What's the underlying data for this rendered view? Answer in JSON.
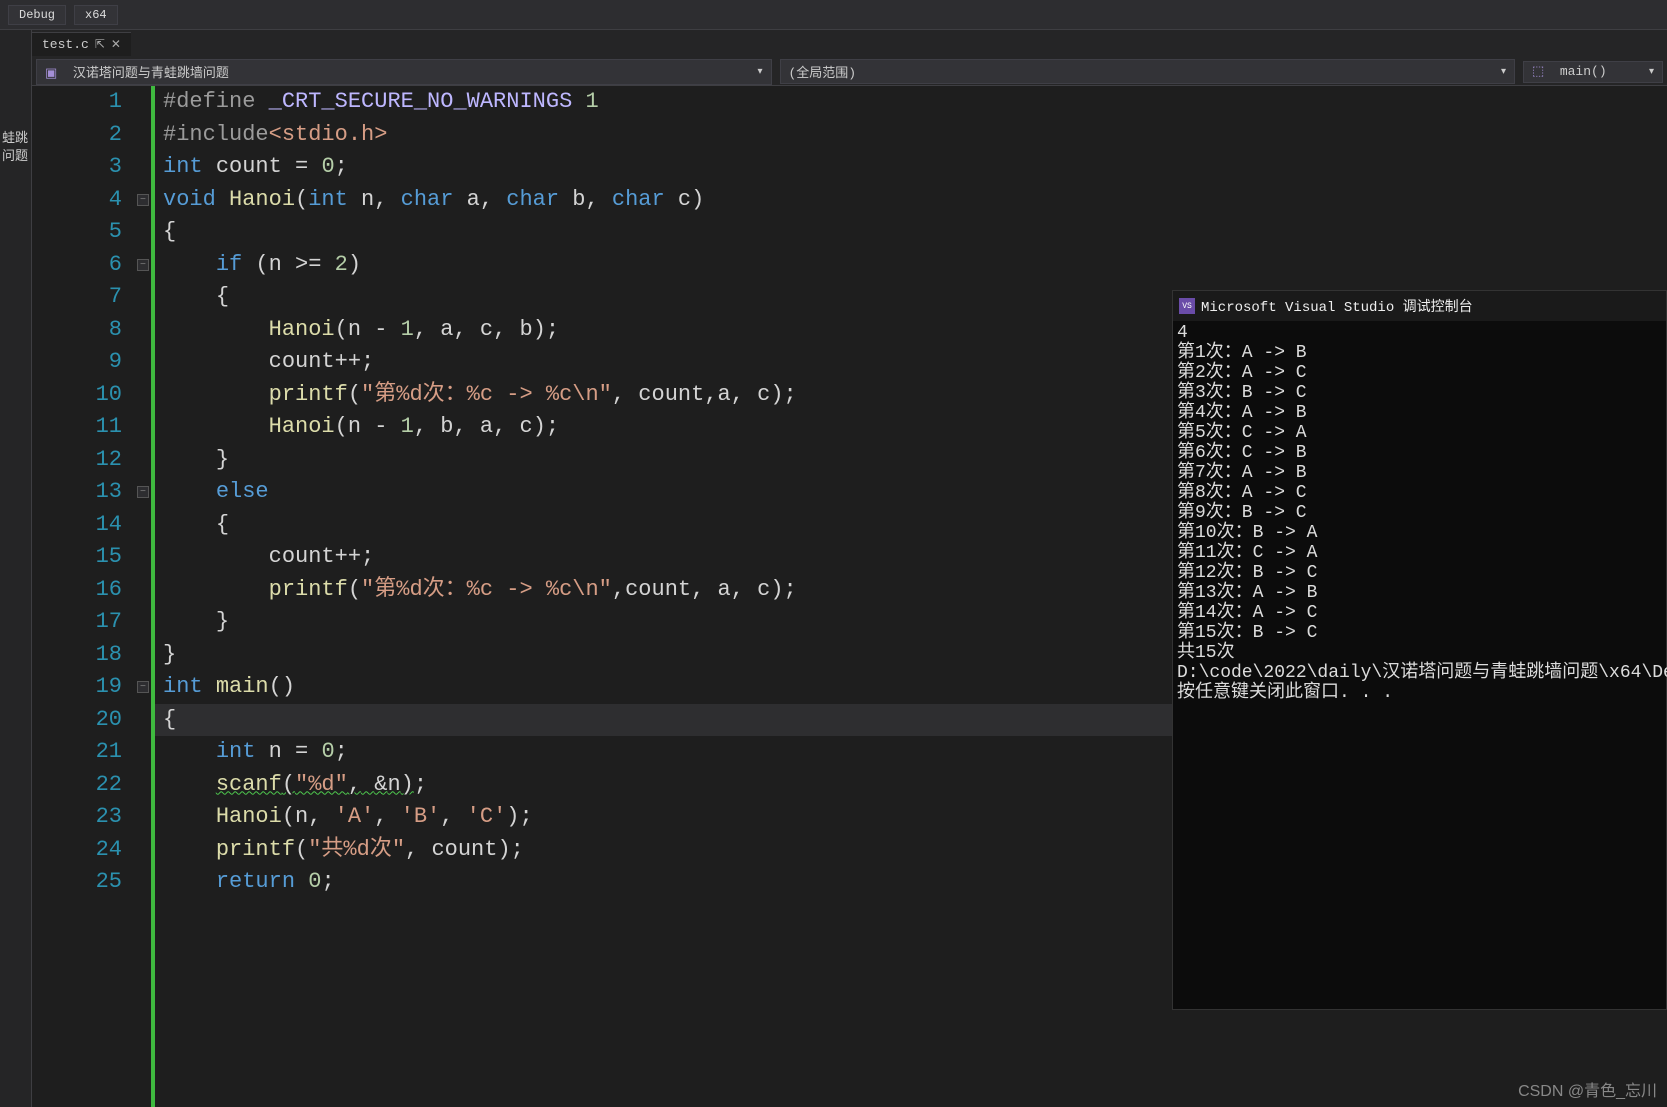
{
  "toolbar": {
    "config": "Debug",
    "platform": "x64"
  },
  "sidebar": {
    "trunc1": "蛙跳",
    "trunc2": "问题"
  },
  "tab": {
    "name": "test.c"
  },
  "nav": {
    "project": "汉诺塔问题与青蛙跳墙问题",
    "scope": "(全局范围)",
    "fn": "main()"
  },
  "code": {
    "lines": [
      {
        "n": 1,
        "html": "<span class='c-pre'>#define</span> <span class='c-macro'>_CRT_SECURE_NO_WARNINGS</span> <span class='c-num'>1</span>"
      },
      {
        "n": 2,
        "html": "<span class='c-pre'>#include</span><span class='c-include'>&lt;stdio.h&gt;</span>"
      },
      {
        "n": 3,
        "html": "<span class='c-kw'>int</span> <span class='c-id'>count</span> <span class='c-op'>=</span> <span class='c-num'>0</span><span class='c-punct'>;</span>"
      },
      {
        "n": 4,
        "fold": true,
        "html": "<span class='c-kw'>void</span> <span class='c-fn'>Hanoi</span><span class='c-punct'>(</span><span class='c-kw'>int</span> <span class='c-id'>n</span><span class='c-punct'>,</span> <span class='c-kw'>char</span> <span class='c-id'>a</span><span class='c-punct'>,</span> <span class='c-kw'>char</span> <span class='c-id'>b</span><span class='c-punct'>,</span> <span class='c-kw'>char</span> <span class='c-id'>c</span><span class='c-punct'>)</span>"
      },
      {
        "n": 5,
        "html": "<span class='c-punct'>{</span>"
      },
      {
        "n": 6,
        "fold": true,
        "html": "    <span class='c-kw'>if</span> <span class='c-punct'>(</span><span class='c-id'>n</span> <span class='c-op'>&gt;=</span> <span class='c-num'>2</span><span class='c-punct'>)</span>"
      },
      {
        "n": 7,
        "html": "    <span class='c-punct'>{</span>"
      },
      {
        "n": 8,
        "html": "        <span class='c-fn'>Hanoi</span><span class='c-punct'>(</span><span class='c-id'>n</span> <span class='c-op'>-</span> <span class='c-num'>1</span><span class='c-punct'>,</span> <span class='c-id'>a</span><span class='c-punct'>,</span> <span class='c-id'>c</span><span class='c-punct'>,</span> <span class='c-id'>b</span><span class='c-punct'>);</span>"
      },
      {
        "n": 9,
        "html": "        <span class='c-id'>count</span><span class='c-op'>++</span><span class='c-punct'>;</span>"
      },
      {
        "n": 10,
        "html": "        <span class='c-fn'>printf</span><span class='c-punct'>(</span><span class='c-str'>\"第%d次：%c -&gt; %c\\n\"</span><span class='c-punct'>,</span> <span class='c-id'>count</span><span class='c-punct'>,</span><span class='c-id'>a</span><span class='c-punct'>,</span> <span class='c-id'>c</span><span class='c-punct'>);</span>"
      },
      {
        "n": 11,
        "html": "        <span class='c-fn'>Hanoi</span><span class='c-punct'>(</span><span class='c-id'>n</span> <span class='c-op'>-</span> <span class='c-num'>1</span><span class='c-punct'>,</span> <span class='c-id'>b</span><span class='c-punct'>,</span> <span class='c-id'>a</span><span class='c-punct'>,</span> <span class='c-id'>c</span><span class='c-punct'>);</span>"
      },
      {
        "n": 12,
        "html": "    <span class='c-punct'>}</span>"
      },
      {
        "n": 13,
        "fold": true,
        "html": "    <span class='c-kw'>else</span>"
      },
      {
        "n": 14,
        "html": "    <span class='c-punct'>{</span>"
      },
      {
        "n": 15,
        "html": "        <span class='c-id'>count</span><span class='c-op'>++</span><span class='c-punct'>;</span>"
      },
      {
        "n": 16,
        "html": "        <span class='c-fn'>printf</span><span class='c-punct'>(</span><span class='c-str'>\"第%d次：%c -&gt; %c\\n\"</span><span class='c-punct'>,</span><span class='c-id'>count</span><span class='c-punct'>,</span> <span class='c-id'>a</span><span class='c-punct'>,</span> <span class='c-id'>c</span><span class='c-punct'>);</span>"
      },
      {
        "n": 17,
        "html": "    <span class='c-punct'>}</span>"
      },
      {
        "n": 18,
        "html": "<span class='c-punct'>}</span>"
      },
      {
        "n": 19,
        "fold": true,
        "html": "<span class='c-kw'>int</span> <span class='c-fn'>main</span><span class='c-punct'>()</span>"
      },
      {
        "n": 20,
        "hl": true,
        "html": "<span class='c-punct'>{</span>"
      },
      {
        "n": 21,
        "html": "    <span class='c-kw'>int</span> <span class='c-id'>n</span> <span class='c-op'>=</span> <span class='c-num'>0</span><span class='c-punct'>;</span>"
      },
      {
        "n": 22,
        "html": "    <span class='c-fn wavy'>scanf</span><span class='c-punct wavy'>(</span><span class='c-str wavy'>\"%d\"</span><span class='c-punct wavy'>,</span><span class='wavy'> </span><span class='c-op wavy'>&amp;</span><span class='c-id wavy'>n</span><span class='c-punct wavy'>)</span><span class='c-punct'>;</span>"
      },
      {
        "n": 23,
        "html": "    <span class='c-fn'>Hanoi</span><span class='c-punct'>(</span><span class='c-id'>n</span><span class='c-punct'>,</span> <span class='c-ch'>'A'</span><span class='c-punct'>,</span> <span class='c-ch'>'B'</span><span class='c-punct'>,</span> <span class='c-ch'>'C'</span><span class='c-punct'>);</span>"
      },
      {
        "n": 24,
        "html": "    <span class='c-fn'>printf</span><span class='c-punct'>(</span><span class='c-str'>\"共%d次\"</span><span class='c-punct'>,</span> <span class='c-id'>count</span><span class='c-punct'>);</span>"
      },
      {
        "n": 25,
        "html": "    <span class='c-kw'>return</span> <span class='c-num'>0</span><span class='c-punct'>;</span>"
      }
    ]
  },
  "console": {
    "title": "Microsoft Visual Studio 调试控制台",
    "lines": [
      "4",
      "第1次：A -> B",
      "第2次：A -> C",
      "第3次：B -> C",
      "第4次：A -> B",
      "第5次：C -> A",
      "第6次：C -> B",
      "第7次：A -> B",
      "第8次：A -> C",
      "第9次：B -> C",
      "第10次：B -> A",
      "第11次：C -> A",
      "第12次：B -> C",
      "第13次：A -> B",
      "第14次：A -> C",
      "第15次：B -> C",
      "共15次",
      "D:\\code\\2022\\daily\\汉诺塔问题与青蛙跳墙问题\\x64\\De",
      "按任意键关闭此窗口. . ."
    ]
  },
  "watermark": "CSDN @青色_忘川"
}
